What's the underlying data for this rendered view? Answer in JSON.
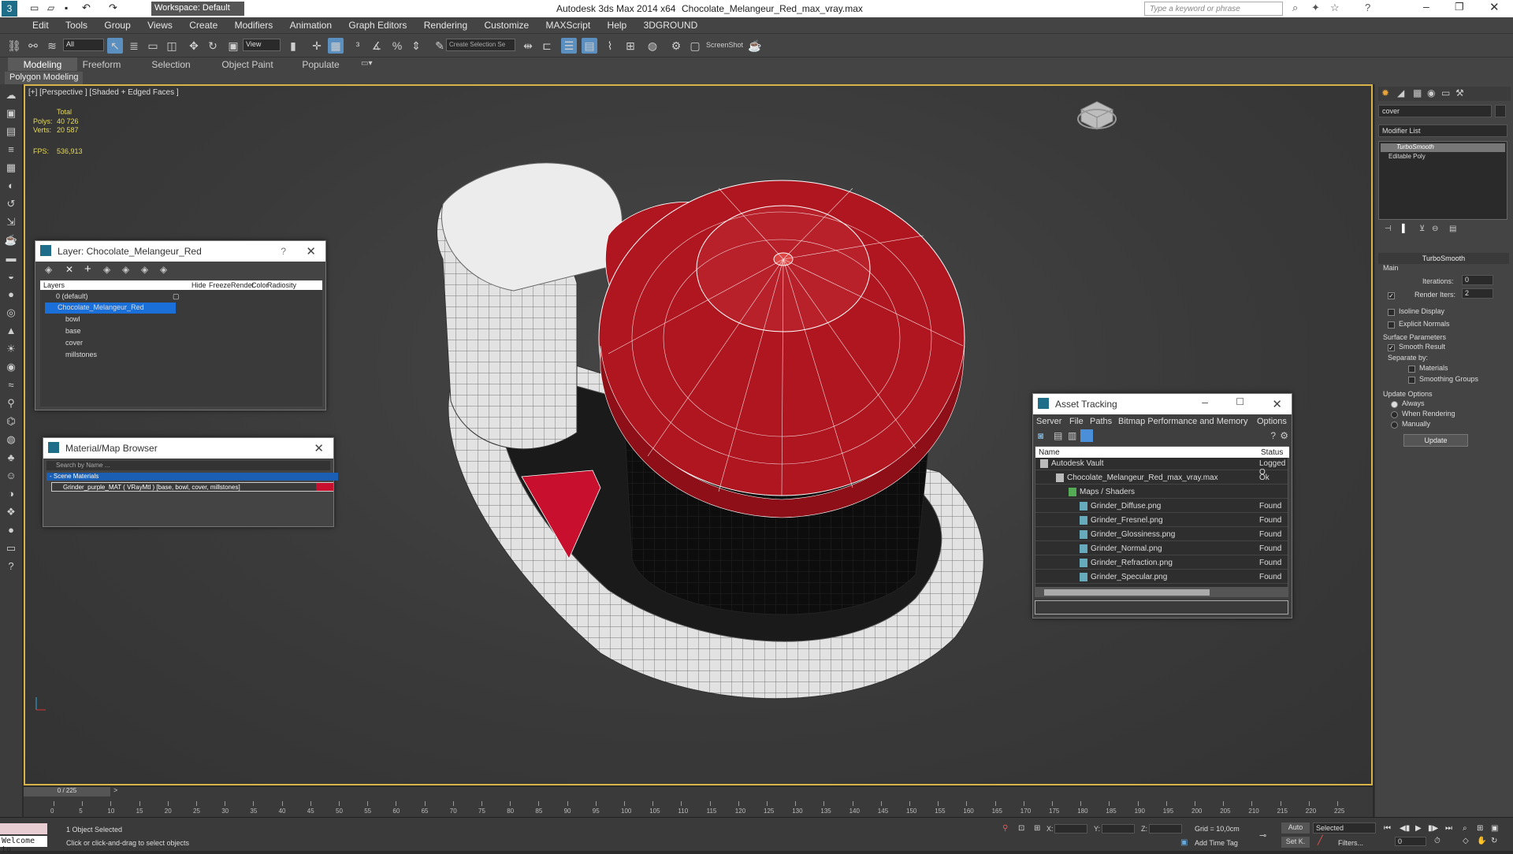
{
  "title": {
    "app": "Autodesk 3ds Max  2014 x64",
    "file": "Chocolate_Melangeur_Red_max_vray.max",
    "workspace": "Workspace: Default",
    "search_placeholder": "Type a keyword or phrase"
  },
  "menu": [
    "Edit",
    "Tools",
    "Group",
    "Views",
    "Create",
    "Modifiers",
    "Animation",
    "Graph Editors",
    "Rendering",
    "Customize",
    "MAXScript",
    "Help",
    "3DGROUND"
  ],
  "toolbar": {
    "filter": "All",
    "view": "View",
    "selection_set": "Create Selection Se",
    "screenshot": "ScreenShot"
  },
  "ribbon": {
    "tabs": [
      "Modeling",
      "Freeform",
      "Selection",
      "Object Paint",
      "Populate"
    ],
    "sub": "Polygon Modeling"
  },
  "viewport": {
    "label": "[+] [Perspective ] [Shaded + Edged Faces ]",
    "total": "Total",
    "polys_label": "Polys:",
    "polys": "40 726",
    "verts_label": "Verts:",
    "verts": "20 587",
    "fps_label": "FPS:",
    "fps": "536,913"
  },
  "layer_win": {
    "title": "Layer: Chocolate_Melangeur_Red",
    "help": "?",
    "cols": [
      "Layers",
      "Hide",
      "Freeze",
      "Render",
      "Color",
      "Radiosity"
    ],
    "rows": [
      "0 (default)",
      "Chocolate_Melangeur_Red",
      "bowl",
      "base",
      "cover",
      "millstones"
    ]
  },
  "material_win": {
    "title": "Material/Map Browser",
    "search": "Search by Name ...",
    "group": "- Scene Materials",
    "item": "Grinder_purple_MAT  ( VRayMtl )  [base, bowl, cover, millstones]"
  },
  "asset_win": {
    "title": "Asset Tracking",
    "menu": [
      "Server",
      "File",
      "Paths",
      "Bitmap Performance and Memory",
      "Options"
    ],
    "col_name": "Name",
    "col_status": "Status",
    "rows": [
      {
        "name": "Autodesk Vault",
        "status": "Logged O"
      },
      {
        "name": "Chocolate_Melangeur_Red_max_vray.max",
        "status": "Ok"
      },
      {
        "name": "Maps / Shaders",
        "status": ""
      },
      {
        "name": "Grinder_Diffuse.png",
        "status": "Found"
      },
      {
        "name": "Grinder_Fresnel.png",
        "status": "Found"
      },
      {
        "name": "Grinder_Glossiness.png",
        "status": "Found"
      },
      {
        "name": "Grinder_Normal.png",
        "status": "Found"
      },
      {
        "name": "Grinder_Refraction.png",
        "status": "Found"
      },
      {
        "name": "Grinder_Specular.png",
        "status": "Found"
      }
    ]
  },
  "right_panel": {
    "name_field": "cover",
    "modifier_list": "Modifier List",
    "stack": [
      "TurboSmooth",
      "Editable Poly"
    ],
    "rollout": "TurboSmooth",
    "main": "Main",
    "iterations_label": "Iterations:",
    "iterations": "0",
    "render_iters_label": "Render Iters:",
    "render_iters": "2",
    "isoline": "Isoline Display",
    "explicit": "Explicit Normals",
    "surface": "Surface Parameters",
    "smooth_result": "Smooth Result",
    "separate": "Separate by:",
    "materials": "Materials",
    "smoothing_groups": "Smoothing Groups",
    "update_options": "Update Options",
    "always": "Always",
    "when_rendering": "When Rendering",
    "manually": "Manually",
    "update": "Update"
  },
  "timeline": {
    "frame": "0 / 225",
    "ticks": [
      "0",
      "5",
      "10",
      "15",
      "20",
      "25",
      "30",
      "35",
      "40",
      "45",
      "50",
      "55",
      "60",
      "65",
      "70",
      "75",
      "80",
      "85",
      "90",
      "95",
      "100",
      "105",
      "110",
      "115",
      "120",
      "125",
      "130",
      "135",
      "140",
      "145",
      "150",
      "155",
      "160",
      "165",
      "170",
      "175",
      "180",
      "185",
      "190",
      "195",
      "200",
      "205",
      "210",
      "215",
      "220",
      "225"
    ]
  },
  "status": {
    "welcome": "Welcome to",
    "selected": "1 Object Selected",
    "hint": "Click or click-and-drag to select objects",
    "x": "X:",
    "y": "Y:",
    "z": "Z:",
    "grid": "Grid = 10,0cm",
    "auto": "Auto",
    "selected_dd": "Selected",
    "setk": "Set K.",
    "filters": "Filters...",
    "add_time_tag": "Add Time Tag",
    "frame_val": "0"
  }
}
